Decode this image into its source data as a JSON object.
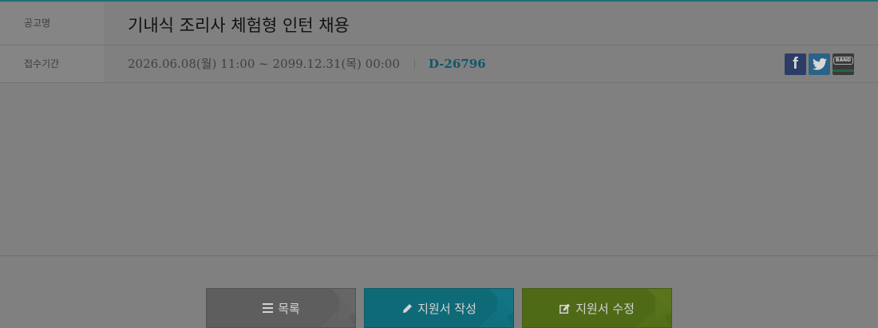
{
  "posting": {
    "title_label": "공고명",
    "title": "기내식 조리사 체험형 인턴 채용",
    "period_label": "접수기간",
    "period": "2026.06.08(월) 11:00 ~ 2099.12.31(목) 00:00",
    "dday": "D-26796"
  },
  "share": {
    "facebook_glyph": "f",
    "band_label": "BAND"
  },
  "actions": {
    "list_label": "목록",
    "write_label": "지원서 작성",
    "edit_label": "지원서 수정"
  },
  "colors": {
    "accent_teal": "#13566a",
    "write_button": "#0f6a78",
    "edit_button": "#4f6a17",
    "list_button": "#5e5e5e"
  }
}
